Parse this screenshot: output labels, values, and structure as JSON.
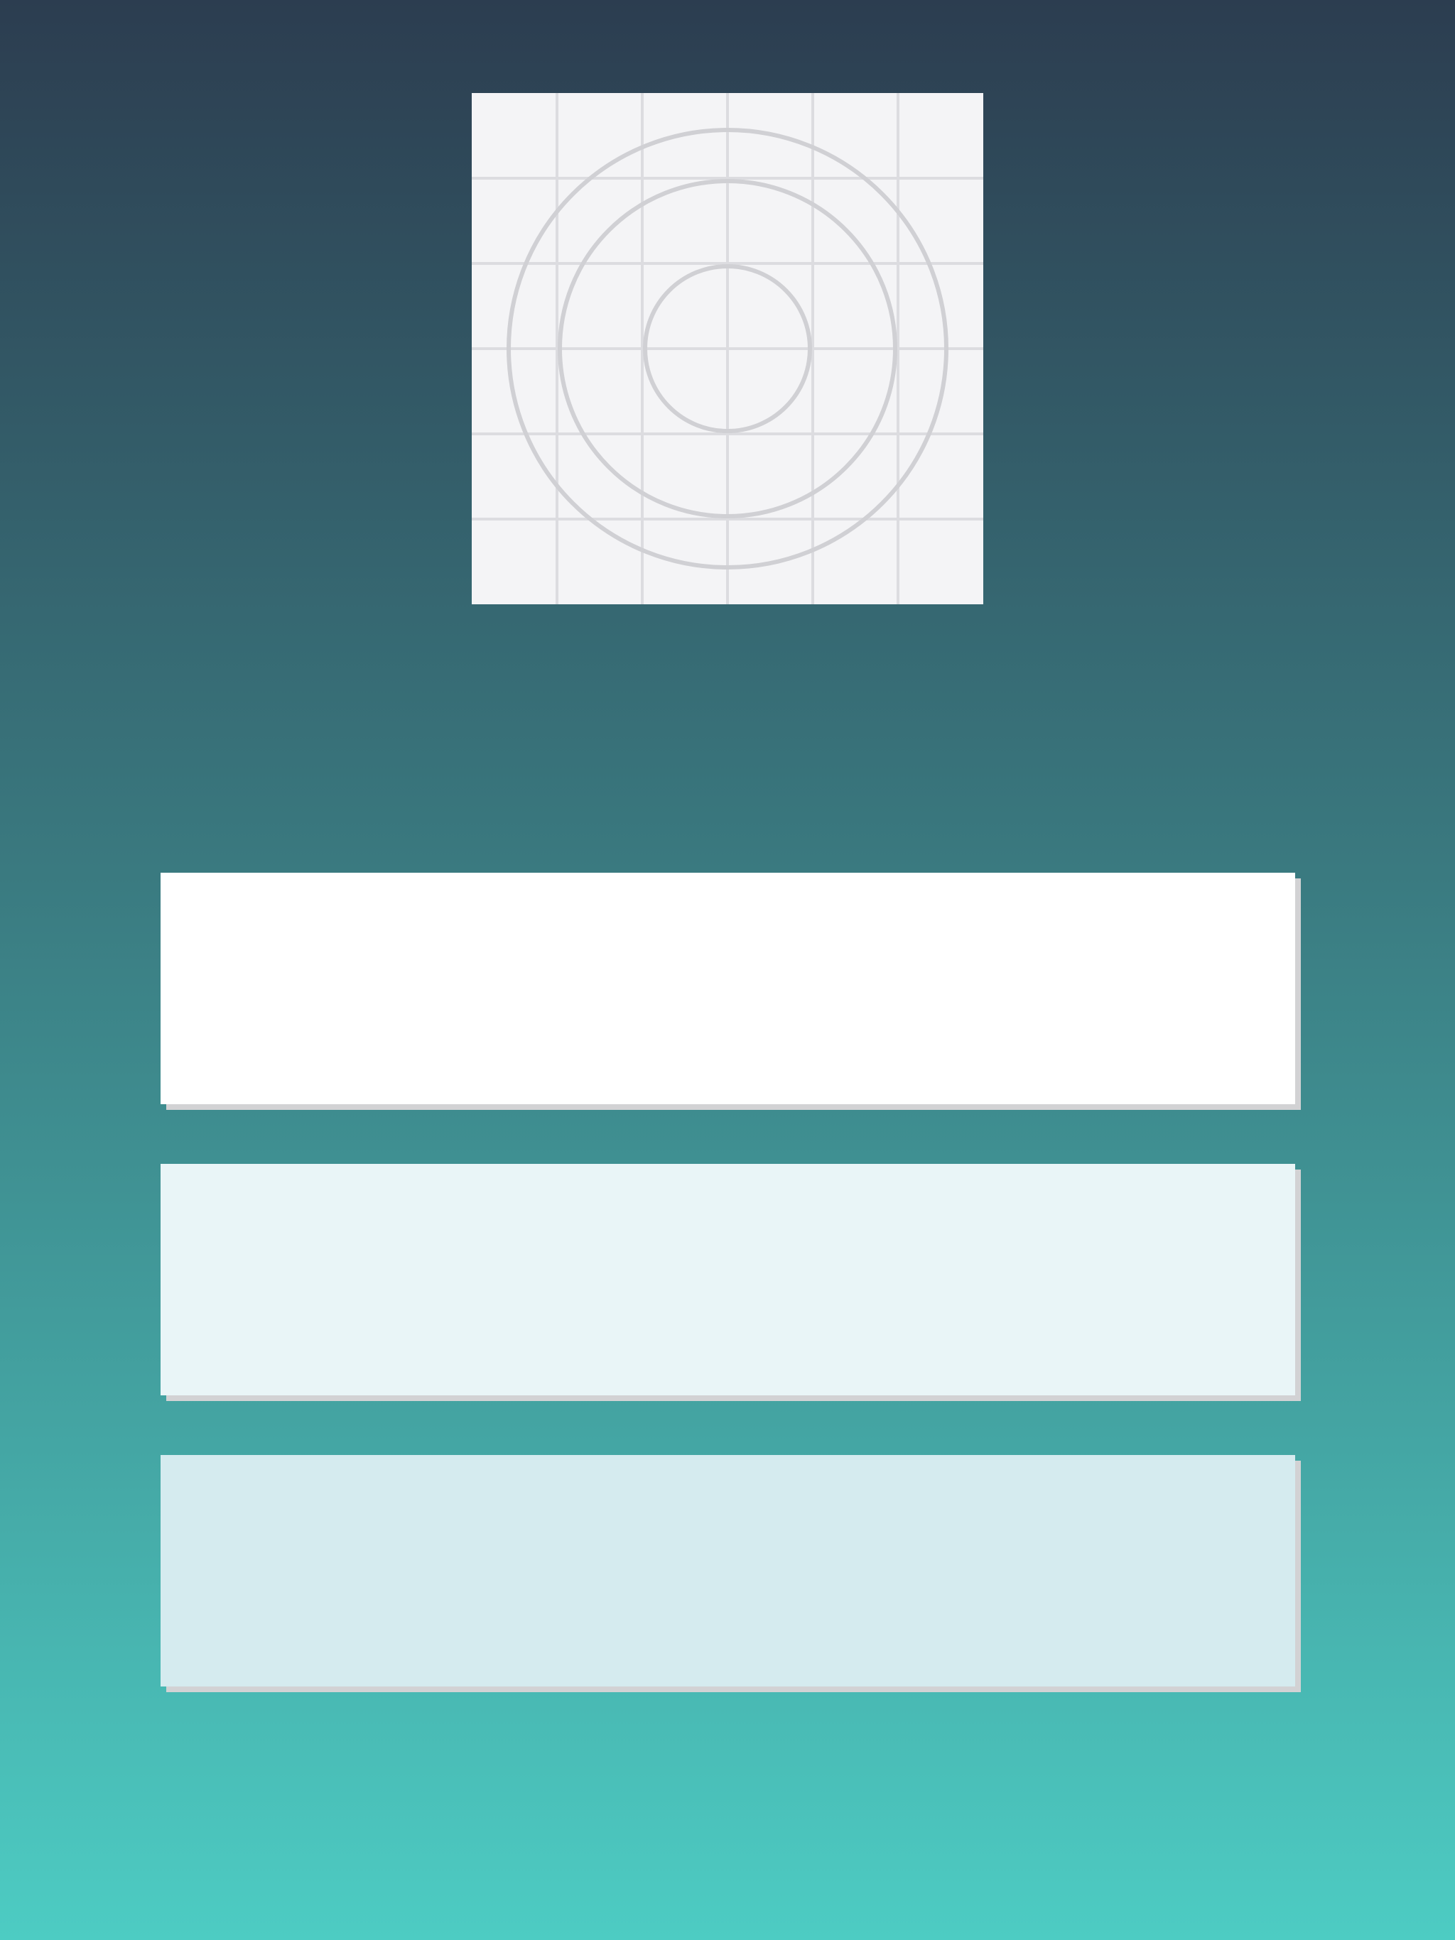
{
  "app_icon": {
    "name": "app-icon-placeholder",
    "background_color": "#f4f4f6",
    "line_color": "#d0d0d4"
  },
  "background": {
    "top_color": "#2c3d50",
    "bottom_color": "#4dccc3"
  },
  "menu_buttons": [
    {
      "label": "",
      "color": "#ffffff"
    },
    {
      "label": "",
      "color": "#e9f5f7"
    },
    {
      "label": "",
      "color": "#d5ebef"
    }
  ]
}
